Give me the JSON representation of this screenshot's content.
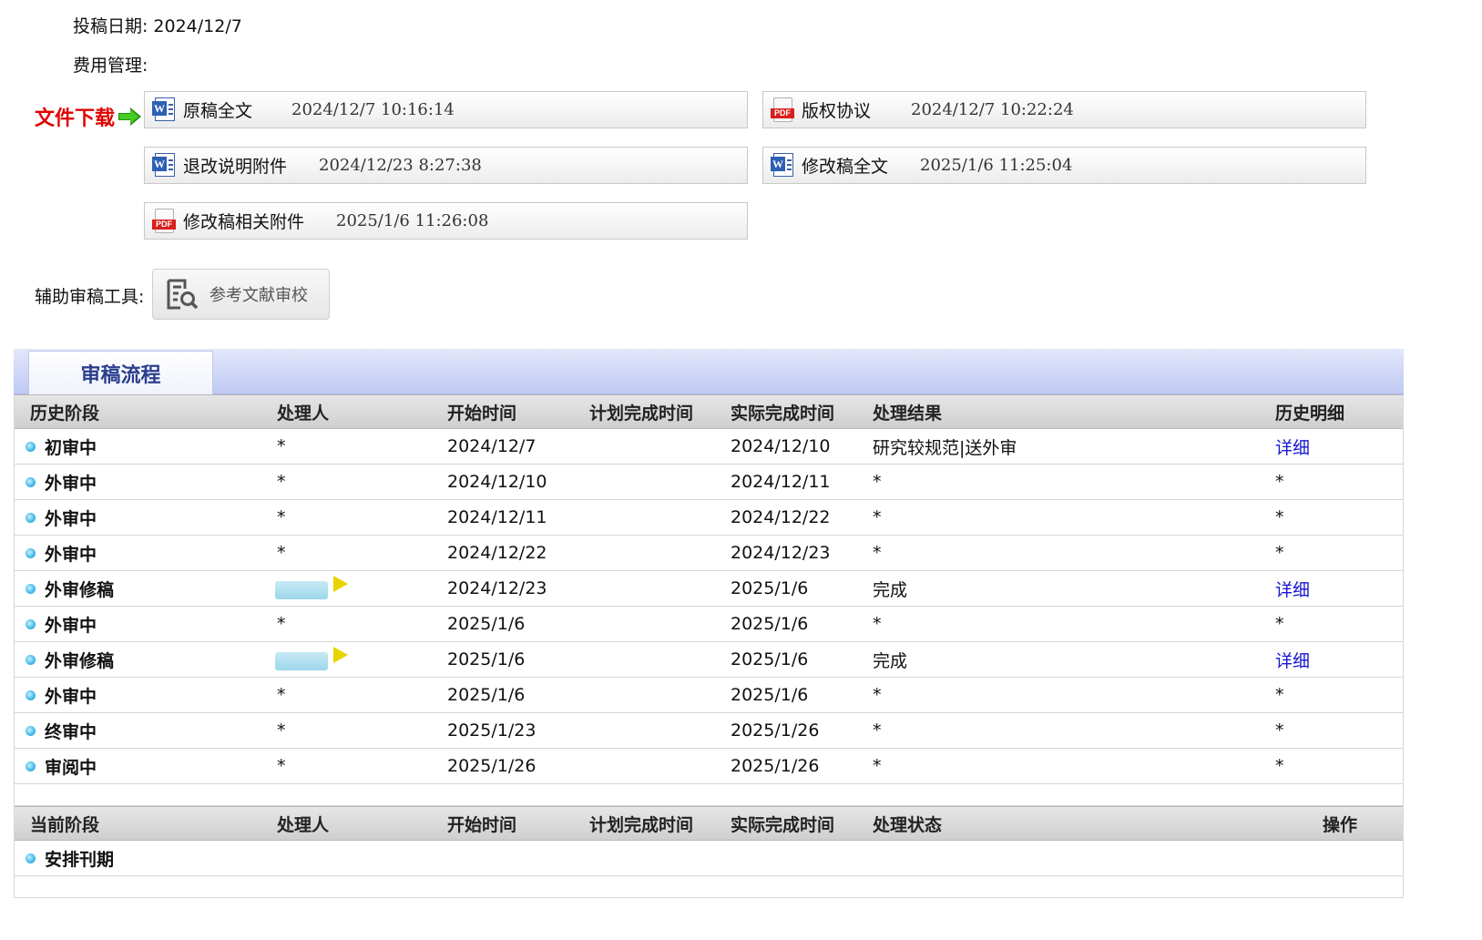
{
  "info": {
    "submit_date_label": "投稿日期:",
    "submit_date": "2024/12/7",
    "fee_label": "费用管理:"
  },
  "downloads": {
    "label": "文件下载",
    "files": [
      {
        "name": "原稿全文",
        "time": "2024/12/7 10:16:14",
        "icon": "word-doc-icon"
      },
      {
        "name": "版权协议",
        "time": "2024/12/7 10:22:24",
        "icon": "pdf-icon"
      },
      {
        "name": "退改说明附件",
        "time": "2024/12/23 8:27:38",
        "icon": "word-doc-icon"
      },
      {
        "name": "修改稿全文",
        "time": "2025/1/6 11:25:04",
        "icon": "word-doc-icon"
      },
      {
        "name": "修改稿相关附件",
        "time": "2025/1/6 11:26:08",
        "icon": "pdf-icon"
      }
    ]
  },
  "tools": {
    "label": "辅助审稿工具:",
    "reference_check": "参考文献审校"
  },
  "workflow": {
    "tab": "审稿流程",
    "history_headers": {
      "stage": "历史阶段",
      "handler": "处理人",
      "start": "开始时间",
      "planned": "计划完成时间",
      "actual": "实际完成时间",
      "result": "处理结果",
      "detail": "历史明细"
    },
    "history": [
      {
        "stage": "初审中",
        "handler": "*",
        "start": "2024/12/7",
        "planned": "",
        "actual": "2024/12/10",
        "result": "研究较规范|送外审",
        "detail": "详细"
      },
      {
        "stage": "外审中",
        "handler": "*",
        "start": "2024/12/10",
        "planned": "",
        "actual": "2024/12/11",
        "result": "*",
        "detail": "*"
      },
      {
        "stage": "外审中",
        "handler": "*",
        "start": "2024/12/11",
        "planned": "",
        "actual": "2024/12/22",
        "result": "*",
        "detail": "*"
      },
      {
        "stage": "外审中",
        "handler": "*",
        "start": "2024/12/22",
        "planned": "",
        "actual": "2024/12/23",
        "result": "*",
        "detail": "*"
      },
      {
        "stage": "外审修稿",
        "handler": "",
        "start": "2024/12/23",
        "planned": "",
        "actual": "2025/1/6",
        "result": "完成",
        "detail": "详细"
      },
      {
        "stage": "外审中",
        "handler": "*",
        "start": "2025/1/6",
        "planned": "",
        "actual": "2025/1/6",
        "result": "*",
        "detail": "*"
      },
      {
        "stage": "外审修稿",
        "handler": "",
        "start": "2025/1/6",
        "planned": "",
        "actual": "2025/1/6",
        "result": "完成",
        "detail": "详细"
      },
      {
        "stage": "外审中",
        "handler": "*",
        "start": "2025/1/6",
        "planned": "",
        "actual": "2025/1/6",
        "result": "*",
        "detail": "*"
      },
      {
        "stage": "终审中",
        "handler": "*",
        "start": "2025/1/23",
        "planned": "",
        "actual": "2025/1/26",
        "result": "*",
        "detail": "*"
      },
      {
        "stage": "审阅中",
        "handler": "*",
        "start": "2025/1/26",
        "planned": "",
        "actual": "2025/1/26",
        "result": "*",
        "detail": "*"
      }
    ],
    "current_headers": {
      "stage": "当前阶段",
      "handler": "处理人",
      "start": "开始时间",
      "planned": "计划完成时间",
      "actual": "实际完成时间",
      "status": "处理状态",
      "action": "操作"
    },
    "current": [
      {
        "stage": "安排刊期"
      }
    ]
  }
}
